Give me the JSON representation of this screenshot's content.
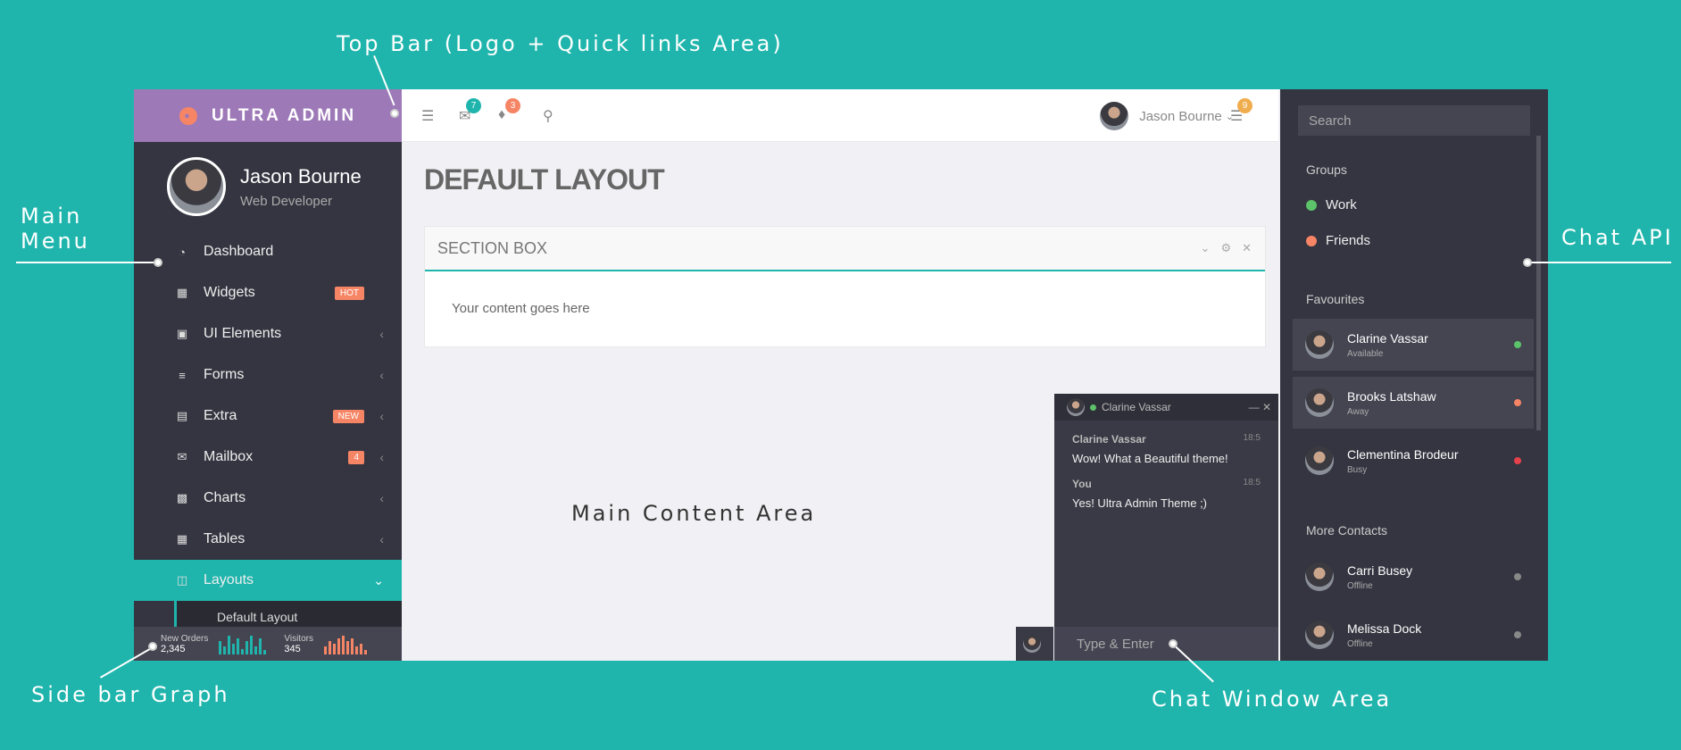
{
  "callouts": {
    "topbar": "Top Bar (Logo + Quick links Area)",
    "main_menu": "Main\nMenu",
    "sidebar_graph": "Side bar Graph",
    "chat_api": "Chat API",
    "chat_window": "Chat Window Area"
  },
  "brand": {
    "name": "ULTRA ADMIN"
  },
  "profile": {
    "name": "Jason Bourne",
    "role": "Web Developer"
  },
  "menu": [
    {
      "label": "Dashboard",
      "icon": "dashboard-icon",
      "badge": ""
    },
    {
      "label": "Widgets",
      "icon": "grid-icon",
      "badge": "HOT"
    },
    {
      "label": "UI Elements",
      "icon": "briefcase-icon",
      "badge": ""
    },
    {
      "label": "Forms",
      "icon": "sliders-icon",
      "badge": ""
    },
    {
      "label": "Extra",
      "icon": "gift-icon",
      "badge": "NEW"
    },
    {
      "label": "Mailbox",
      "icon": "envelope-icon",
      "badge": "4"
    },
    {
      "label": "Charts",
      "icon": "bar-chart-icon",
      "badge": ""
    },
    {
      "label": "Tables",
      "icon": "table-icon",
      "badge": ""
    },
    {
      "label": "Layouts",
      "icon": "columns-icon",
      "badge": ""
    }
  ],
  "submenu": {
    "label": "Default Layout"
  },
  "sidebar_stats": [
    {
      "label": "New Orders",
      "value": "2,345",
      "bars": [
        10,
        6,
        14,
        8,
        12,
        4,
        10,
        14,
        6,
        12,
        3
      ],
      "color": "#1fb5ac"
    },
    {
      "label": "Visitors",
      "value": "345",
      "bars": [
        6,
        10,
        8,
        12,
        14,
        10,
        12,
        6,
        8,
        3
      ],
      "color": "#f68565"
    }
  ],
  "topbar": {
    "mail_count": "7",
    "notif_count": "3",
    "user": "Jason Bourne",
    "chat_count": "9",
    "mail_color": "#1fb5ac",
    "notif_color": "#f68565",
    "chat_color": "#f0ad4e"
  },
  "page": {
    "title": "DEFAULT LAYOUT",
    "section_title": "SECTION BOX",
    "section_body": "Your content goes here",
    "area_label": "Main Content Area"
  },
  "chat_window": {
    "contact": "Clarine Vassar",
    "messages": [
      {
        "from": "Clarine Vassar",
        "time": "18:5",
        "text": "Wow! What a Beautiful theme!"
      },
      {
        "from": "You",
        "time": "18:5",
        "text": "Yes! Ultra Admin Theme ;)"
      }
    ],
    "input_placeholder": "Type & Enter"
  },
  "chat_panel": {
    "search_placeholder": "Search",
    "groups_heading": "Groups",
    "groups": [
      {
        "name": "Work",
        "color": "#5cc36a"
      },
      {
        "name": "Friends",
        "color": "#f68565"
      }
    ],
    "favourites_heading": "Favourites",
    "favourites": [
      {
        "name": "Clarine Vassar",
        "status": "Available",
        "color": "#5cc36a"
      },
      {
        "name": "Brooks Latshaw",
        "status": "Away",
        "color": "#f68565"
      },
      {
        "name": "Clementina Brodeur",
        "status": "Busy",
        "color": "#e5414a"
      }
    ],
    "more_heading": "More Contacts",
    "more": [
      {
        "name": "Carri Busey",
        "status": "Offline",
        "color": "#888888"
      },
      {
        "name": "Melissa Dock",
        "status": "Offline",
        "color": "#888888"
      }
    ]
  }
}
